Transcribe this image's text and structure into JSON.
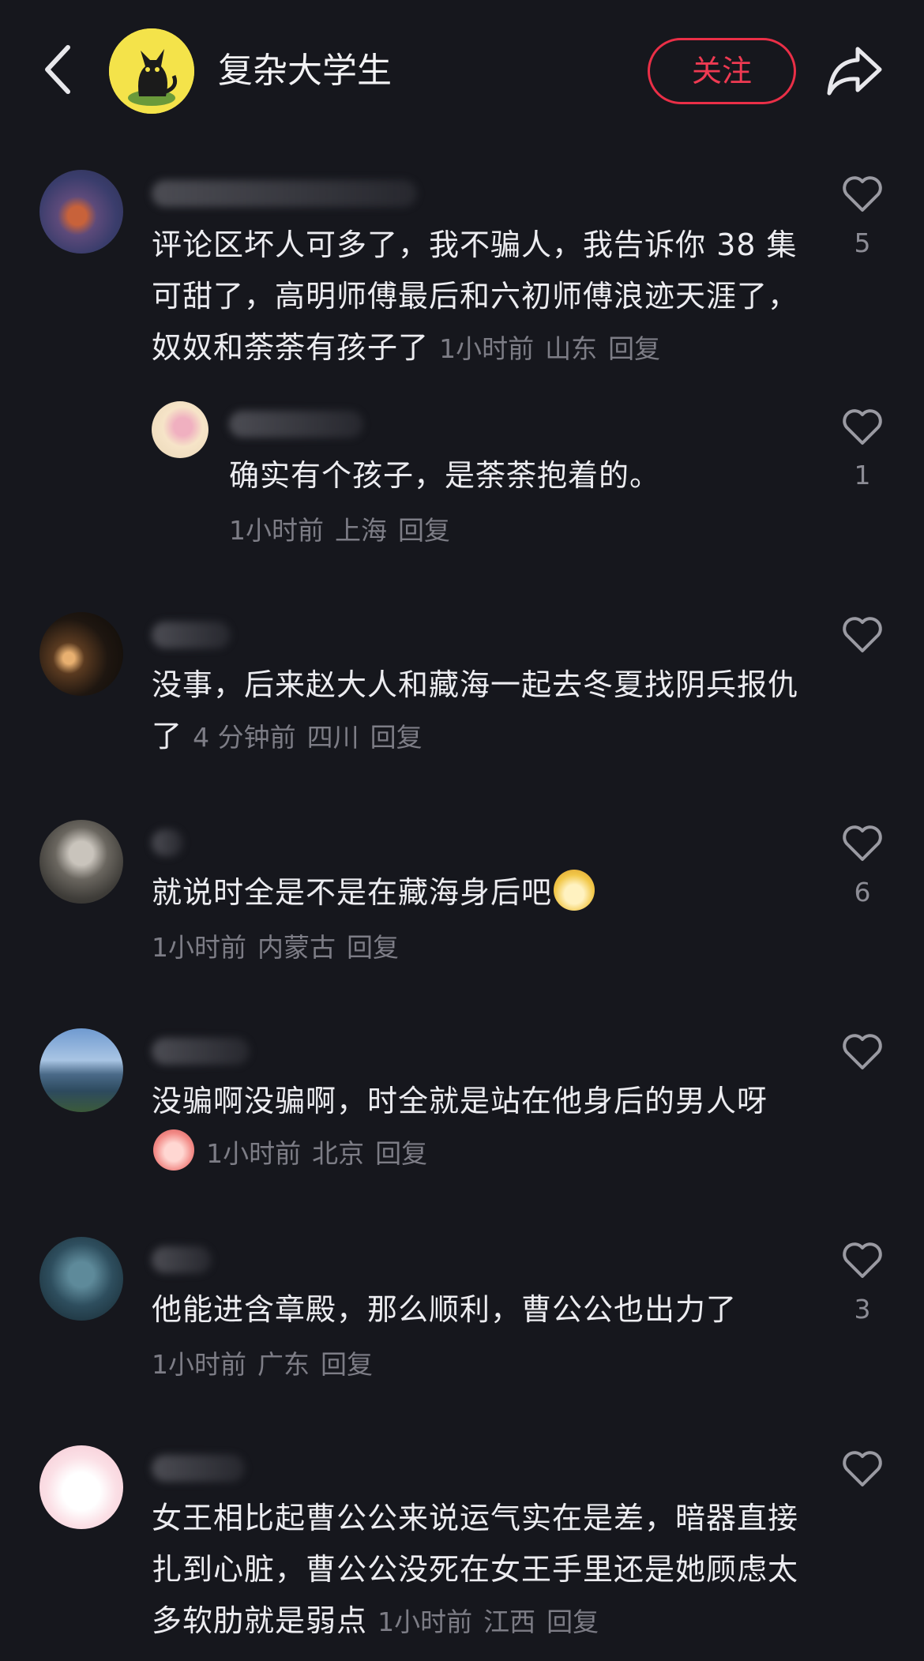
{
  "header": {
    "account_name": "复杂大学生",
    "follow_label": "关注"
  },
  "comments": [
    {
      "text": "评论区坏人可多了，我不骗人，我告诉你 38 集可甜了，高明师傅最后和六初师傅浪迹天涯了，奴奴和荼荼有孩子了",
      "time": "1小时前",
      "location": "山东",
      "reply_label": "回复",
      "likes": "5"
    },
    {
      "text": "确实有个孩子，是荼荼抱着的。",
      "time": "1小时前",
      "location": "上海",
      "reply_label": "回复",
      "likes": "1"
    },
    {
      "text": "没事，后来赵大人和藏海一起去冬夏找阴兵报仇了",
      "time": "4 分钟前",
      "location": "四川",
      "reply_label": "回复",
      "likes": ""
    },
    {
      "text": "就说时全是不是在藏海身后吧",
      "time": "1小时前",
      "location": "内蒙古",
      "reply_label": "回复",
      "likes": "6"
    },
    {
      "text": "没骗啊没骗啊，时全就是站在他身后的男人呀",
      "time": "1小时前",
      "location": "北京",
      "reply_label": "回复",
      "likes": ""
    },
    {
      "text": "他能进含章殿，那么顺利，曹公公也出力了",
      "time": "1小时前",
      "location": "广东",
      "reply_label": "回复",
      "likes": "3"
    },
    {
      "text": "女王相比起曹公公来说运气实在是差，暗器直接扎到心脏，曹公公没死在女王手里还是她顾虑太多软肋就是弱点",
      "time": "1小时前",
      "location": "江西",
      "reply_label": "回复",
      "likes": ""
    }
  ]
}
